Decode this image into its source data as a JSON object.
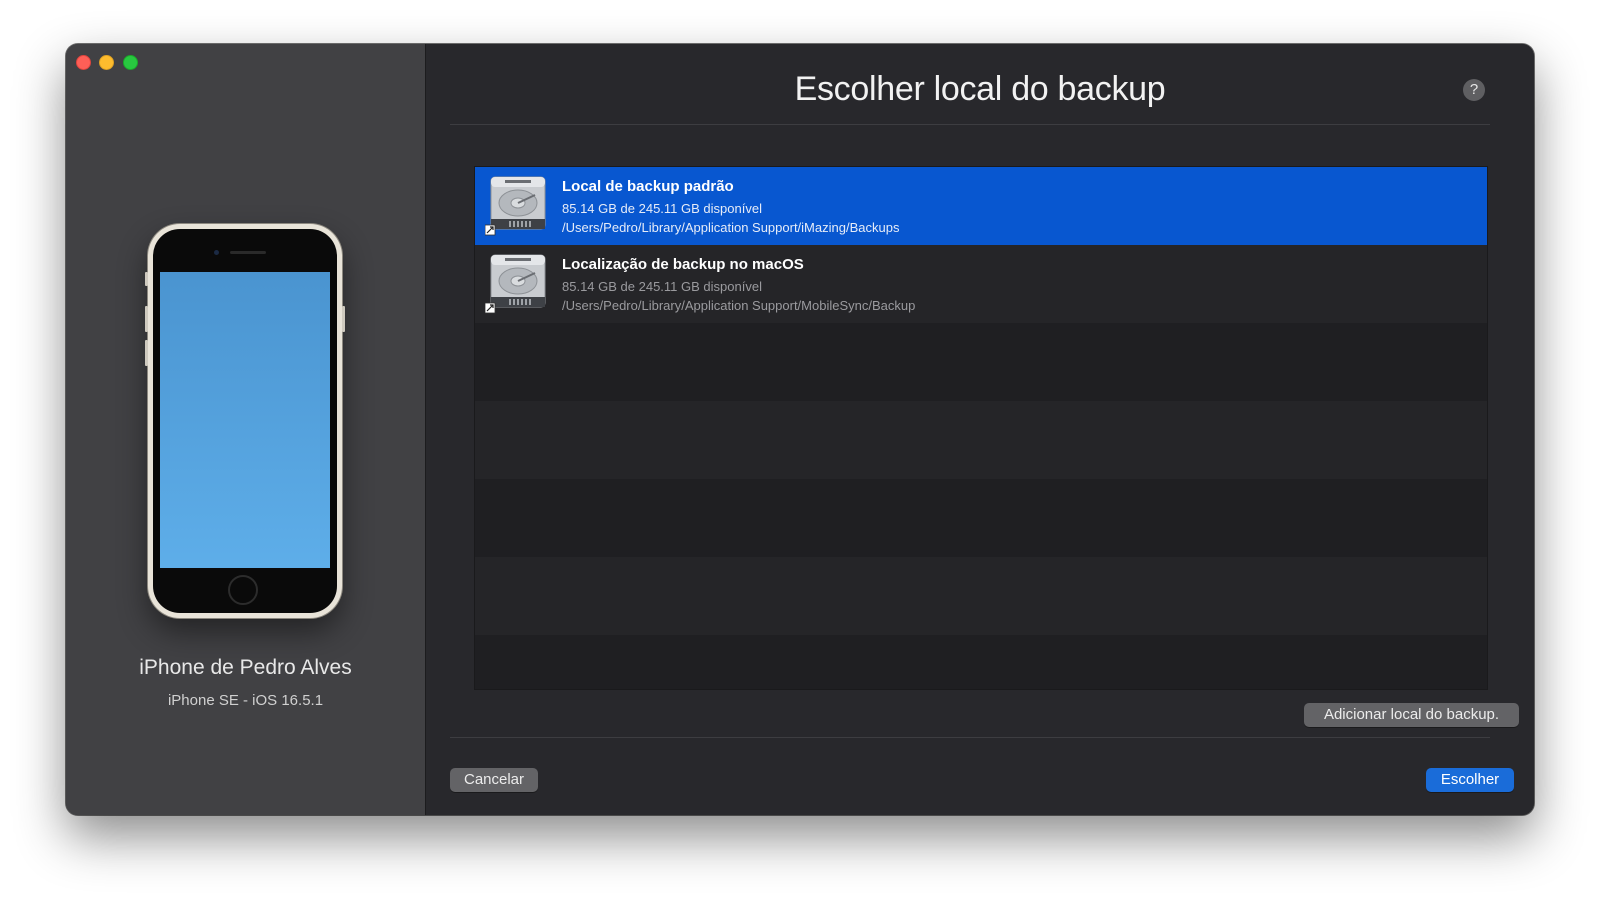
{
  "window": {
    "controls": [
      "close",
      "minimize",
      "maximize"
    ]
  },
  "sidebar": {
    "device_name": "iPhone de Pedro Alves",
    "device_model": "iPhone SE - iOS 16.5.1"
  },
  "dialog": {
    "title": "Escolher local do backup",
    "help_label": "?"
  },
  "locations": [
    {
      "title": "Local de backup padrão",
      "space": "85.14 GB de 245.11 GB disponível",
      "path": "/Users/Pedro/Library/Application Support/iMazing/Backups",
      "selected": true,
      "icon": "hard-drive-icon"
    },
    {
      "title": "Localização de backup no macOS",
      "space": "85.14 GB de 245.11 GB disponível",
      "path": "/Users/Pedro/Library/Application Support/MobileSync/Backup",
      "selected": false,
      "icon": "hard-drive-icon"
    }
  ],
  "buttons": {
    "add_location": "Adicionar local do backup.",
    "cancel": "Cancelar",
    "choose": "Escolher"
  },
  "colors": {
    "accent": "#0857d0",
    "close": "#fe5f57",
    "minimize": "#febc2e",
    "maximize": "#28c840"
  }
}
